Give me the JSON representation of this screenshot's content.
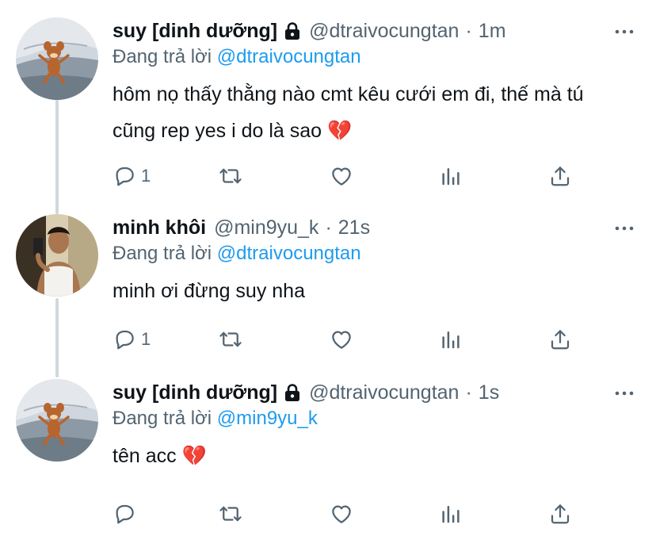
{
  "tweets": [
    {
      "display_name": "suy [dinh dưỡng]",
      "locked": true,
      "handle": "@dtraivocungtan",
      "separator": "·",
      "time": "1m",
      "reply_prefix": "Đang trả lời",
      "reply_mention": "@dtraivocungtan",
      "text": "hôm nọ thấy thằng nào cmt kêu cưới em đi, thế mà tú cũng rep yes i do là sao 💔",
      "reply_count": "1",
      "avatar_icon": "jerry-mouse-avatar"
    },
    {
      "display_name": "minh khôi",
      "locked": false,
      "handle": "@min9yu_k",
      "separator": "·",
      "time": "21s",
      "reply_prefix": "Đang trả lời",
      "reply_mention": "@dtraivocungtan",
      "text": "minh ơi đừng suy nha",
      "reply_count": "1",
      "avatar_icon": "person-selfie-avatar"
    },
    {
      "display_name": "suy [dinh dưỡng]",
      "locked": true,
      "handle": "@dtraivocungtan",
      "separator": "·",
      "time": "1s",
      "reply_prefix": "Đang trả lời",
      "reply_mention": "@min9yu_k",
      "text": "tên acc 💔",
      "reply_count": "",
      "avatar_icon": "jerry-mouse-avatar"
    }
  ],
  "icons": {
    "reply": "reply-icon",
    "retweet": "retweet-icon",
    "like": "heart-icon",
    "stats": "analytics-icon",
    "share": "share-icon",
    "more": "more-icon",
    "lock": "lock-icon"
  },
  "colors": {
    "text": "#0f1419",
    "secondary": "#536471",
    "link": "#1d9bf0",
    "thread_line": "#cfd9de"
  }
}
